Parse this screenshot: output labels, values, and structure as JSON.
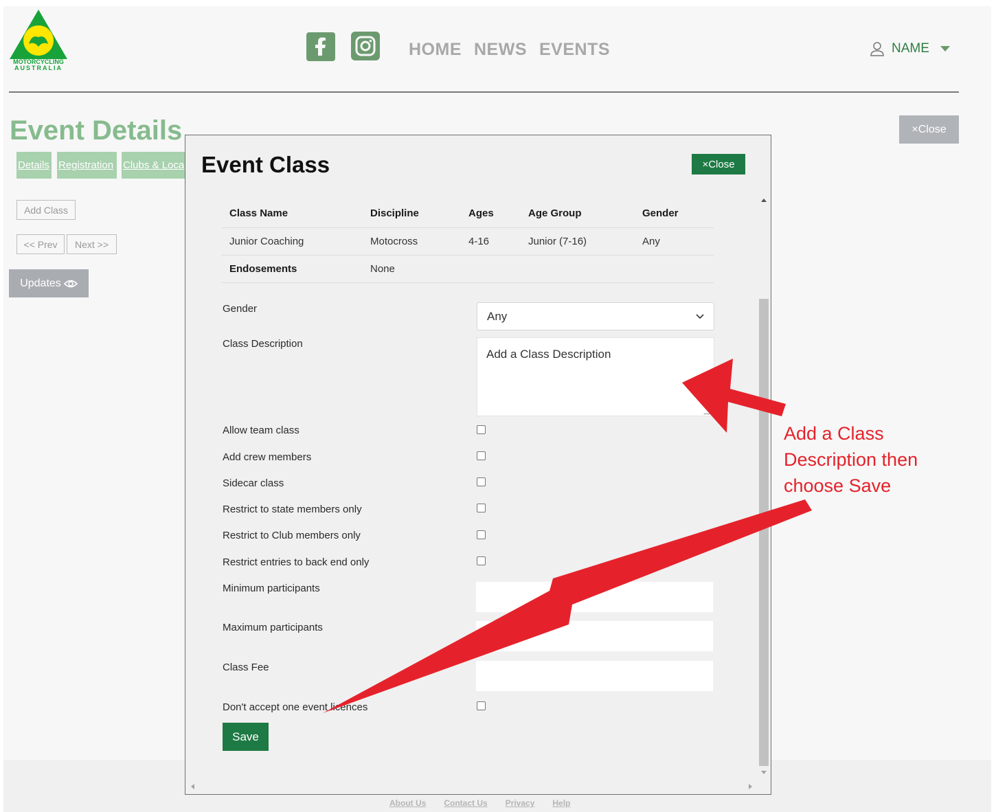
{
  "header": {
    "logo_text_1": "MOTORCYCLING",
    "logo_text_2": "AUSTRALIA",
    "nav": [
      "HOME",
      "NEWS",
      "EVENTS"
    ],
    "user_label": "NAME"
  },
  "page": {
    "title": "Event Details",
    "close_label": "Close",
    "tabs": [
      "Details",
      "Registration",
      "Clubs & Loca"
    ],
    "add_class_label": "Add Class",
    "prev_label": "<< Prev",
    "next_label": "Next >>",
    "updates_label": "Updates"
  },
  "footer": {
    "links": [
      "About Us",
      "Contact Us",
      "Privacy",
      "Help"
    ]
  },
  "modal": {
    "title": "Event Class",
    "close_label": "Close",
    "table": {
      "headers": [
        "Class Name",
        "Discipline",
        "Ages",
        "Age Group",
        "Gender"
      ],
      "row": [
        "Junior Coaching",
        "Motocross",
        "4-16",
        "Junior (7-16)",
        "Any"
      ],
      "endorsements_label": "Endosements",
      "endorsements_value": "None"
    },
    "form": {
      "gender_label": "Gender",
      "gender_value": "Any",
      "description_label": "Class Description",
      "description_value": "Add a Class Description",
      "checkboxes": [
        "Allow team class",
        "Add crew members",
        "Sidecar class",
        "Restrict to state members only",
        "Restrict to Club members only",
        "Restrict entries to back end only"
      ],
      "min_label": "Minimum participants",
      "max_label": "Maximum participants",
      "fee_label": "Class Fee",
      "one_event_label": "Don't accept one event licences",
      "save_label": "Save"
    }
  },
  "annotation": {
    "line_1": "Add a Class",
    "line_2": "Description then",
    "line_3": "choose Save",
    "color": "#e5222b"
  }
}
